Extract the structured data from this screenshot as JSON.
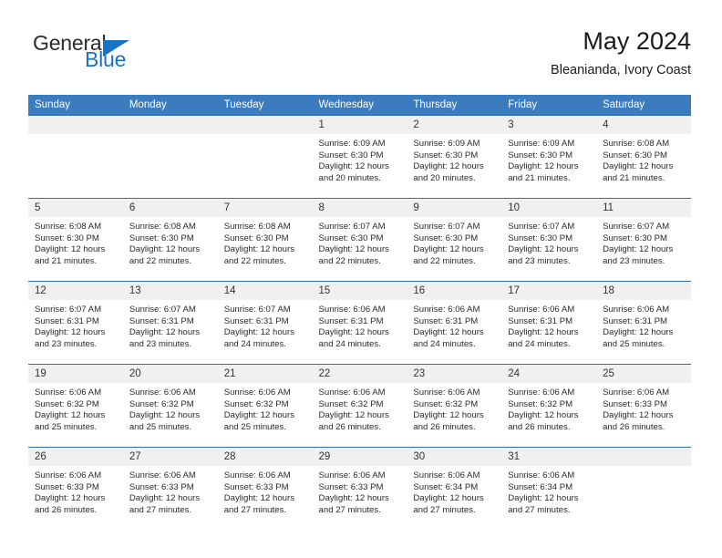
{
  "brand": {
    "name_top": "General",
    "name_bottom": "Blue",
    "accent_color": "#1773c4"
  },
  "header": {
    "title": "May 2024",
    "subtitle": "Bleanianda, Ivory Coast"
  },
  "theme": {
    "header_blue": "#3a7cbe",
    "rule_blue": "#2f6fae",
    "daynum_band": "#f0f0f0"
  },
  "weekday_headers": [
    "Sunday",
    "Monday",
    "Tuesday",
    "Wednesday",
    "Thursday",
    "Friday",
    "Saturday"
  ],
  "weeks": [
    [
      {
        "day": "",
        "sunrise": "",
        "sunset": "",
        "daylight_line1": "",
        "daylight_line2": ""
      },
      {
        "day": "",
        "sunrise": "",
        "sunset": "",
        "daylight_line1": "",
        "daylight_line2": ""
      },
      {
        "day": "",
        "sunrise": "",
        "sunset": "",
        "daylight_line1": "",
        "daylight_line2": ""
      },
      {
        "day": "1",
        "sunrise": "Sunrise: 6:09 AM",
        "sunset": "Sunset: 6:30 PM",
        "daylight_line1": "Daylight: 12 hours",
        "daylight_line2": "and 20 minutes."
      },
      {
        "day": "2",
        "sunrise": "Sunrise: 6:09 AM",
        "sunset": "Sunset: 6:30 PM",
        "daylight_line1": "Daylight: 12 hours",
        "daylight_line2": "and 20 minutes."
      },
      {
        "day": "3",
        "sunrise": "Sunrise: 6:09 AM",
        "sunset": "Sunset: 6:30 PM",
        "daylight_line1": "Daylight: 12 hours",
        "daylight_line2": "and 21 minutes."
      },
      {
        "day": "4",
        "sunrise": "Sunrise: 6:08 AM",
        "sunset": "Sunset: 6:30 PM",
        "daylight_line1": "Daylight: 12 hours",
        "daylight_line2": "and 21 minutes."
      }
    ],
    [
      {
        "day": "5",
        "sunrise": "Sunrise: 6:08 AM",
        "sunset": "Sunset: 6:30 PM",
        "daylight_line1": "Daylight: 12 hours",
        "daylight_line2": "and 21 minutes."
      },
      {
        "day": "6",
        "sunrise": "Sunrise: 6:08 AM",
        "sunset": "Sunset: 6:30 PM",
        "daylight_line1": "Daylight: 12 hours",
        "daylight_line2": "and 22 minutes."
      },
      {
        "day": "7",
        "sunrise": "Sunrise: 6:08 AM",
        "sunset": "Sunset: 6:30 PM",
        "daylight_line1": "Daylight: 12 hours",
        "daylight_line2": "and 22 minutes."
      },
      {
        "day": "8",
        "sunrise": "Sunrise: 6:07 AM",
        "sunset": "Sunset: 6:30 PM",
        "daylight_line1": "Daylight: 12 hours",
        "daylight_line2": "and 22 minutes."
      },
      {
        "day": "9",
        "sunrise": "Sunrise: 6:07 AM",
        "sunset": "Sunset: 6:30 PM",
        "daylight_line1": "Daylight: 12 hours",
        "daylight_line2": "and 22 minutes."
      },
      {
        "day": "10",
        "sunrise": "Sunrise: 6:07 AM",
        "sunset": "Sunset: 6:30 PM",
        "daylight_line1": "Daylight: 12 hours",
        "daylight_line2": "and 23 minutes."
      },
      {
        "day": "11",
        "sunrise": "Sunrise: 6:07 AM",
        "sunset": "Sunset: 6:30 PM",
        "daylight_line1": "Daylight: 12 hours",
        "daylight_line2": "and 23 minutes."
      }
    ],
    [
      {
        "day": "12",
        "sunrise": "Sunrise: 6:07 AM",
        "sunset": "Sunset: 6:31 PM",
        "daylight_line1": "Daylight: 12 hours",
        "daylight_line2": "and 23 minutes."
      },
      {
        "day": "13",
        "sunrise": "Sunrise: 6:07 AM",
        "sunset": "Sunset: 6:31 PM",
        "daylight_line1": "Daylight: 12 hours",
        "daylight_line2": "and 23 minutes."
      },
      {
        "day": "14",
        "sunrise": "Sunrise: 6:07 AM",
        "sunset": "Sunset: 6:31 PM",
        "daylight_line1": "Daylight: 12 hours",
        "daylight_line2": "and 24 minutes."
      },
      {
        "day": "15",
        "sunrise": "Sunrise: 6:06 AM",
        "sunset": "Sunset: 6:31 PM",
        "daylight_line1": "Daylight: 12 hours",
        "daylight_line2": "and 24 minutes."
      },
      {
        "day": "16",
        "sunrise": "Sunrise: 6:06 AM",
        "sunset": "Sunset: 6:31 PM",
        "daylight_line1": "Daylight: 12 hours",
        "daylight_line2": "and 24 minutes."
      },
      {
        "day": "17",
        "sunrise": "Sunrise: 6:06 AM",
        "sunset": "Sunset: 6:31 PM",
        "daylight_line1": "Daylight: 12 hours",
        "daylight_line2": "and 24 minutes."
      },
      {
        "day": "18",
        "sunrise": "Sunrise: 6:06 AM",
        "sunset": "Sunset: 6:31 PM",
        "daylight_line1": "Daylight: 12 hours",
        "daylight_line2": "and 25 minutes."
      }
    ],
    [
      {
        "day": "19",
        "sunrise": "Sunrise: 6:06 AM",
        "sunset": "Sunset: 6:32 PM",
        "daylight_line1": "Daylight: 12 hours",
        "daylight_line2": "and 25 minutes."
      },
      {
        "day": "20",
        "sunrise": "Sunrise: 6:06 AM",
        "sunset": "Sunset: 6:32 PM",
        "daylight_line1": "Daylight: 12 hours",
        "daylight_line2": "and 25 minutes."
      },
      {
        "day": "21",
        "sunrise": "Sunrise: 6:06 AM",
        "sunset": "Sunset: 6:32 PM",
        "daylight_line1": "Daylight: 12 hours",
        "daylight_line2": "and 25 minutes."
      },
      {
        "day": "22",
        "sunrise": "Sunrise: 6:06 AM",
        "sunset": "Sunset: 6:32 PM",
        "daylight_line1": "Daylight: 12 hours",
        "daylight_line2": "and 26 minutes."
      },
      {
        "day": "23",
        "sunrise": "Sunrise: 6:06 AM",
        "sunset": "Sunset: 6:32 PM",
        "daylight_line1": "Daylight: 12 hours",
        "daylight_line2": "and 26 minutes."
      },
      {
        "day": "24",
        "sunrise": "Sunrise: 6:06 AM",
        "sunset": "Sunset: 6:32 PM",
        "daylight_line1": "Daylight: 12 hours",
        "daylight_line2": "and 26 minutes."
      },
      {
        "day": "25",
        "sunrise": "Sunrise: 6:06 AM",
        "sunset": "Sunset: 6:33 PM",
        "daylight_line1": "Daylight: 12 hours",
        "daylight_line2": "and 26 minutes."
      }
    ],
    [
      {
        "day": "26",
        "sunrise": "Sunrise: 6:06 AM",
        "sunset": "Sunset: 6:33 PM",
        "daylight_line1": "Daylight: 12 hours",
        "daylight_line2": "and 26 minutes."
      },
      {
        "day": "27",
        "sunrise": "Sunrise: 6:06 AM",
        "sunset": "Sunset: 6:33 PM",
        "daylight_line1": "Daylight: 12 hours",
        "daylight_line2": "and 27 minutes."
      },
      {
        "day": "28",
        "sunrise": "Sunrise: 6:06 AM",
        "sunset": "Sunset: 6:33 PM",
        "daylight_line1": "Daylight: 12 hours",
        "daylight_line2": "and 27 minutes."
      },
      {
        "day": "29",
        "sunrise": "Sunrise: 6:06 AM",
        "sunset": "Sunset: 6:33 PM",
        "daylight_line1": "Daylight: 12 hours",
        "daylight_line2": "and 27 minutes."
      },
      {
        "day": "30",
        "sunrise": "Sunrise: 6:06 AM",
        "sunset": "Sunset: 6:34 PM",
        "daylight_line1": "Daylight: 12 hours",
        "daylight_line2": "and 27 minutes."
      },
      {
        "day": "31",
        "sunrise": "Sunrise: 6:06 AM",
        "sunset": "Sunset: 6:34 PM",
        "daylight_line1": "Daylight: 12 hours",
        "daylight_line2": "and 27 minutes."
      },
      {
        "day": "",
        "sunrise": "",
        "sunset": "",
        "daylight_line1": "",
        "daylight_line2": ""
      }
    ]
  ]
}
